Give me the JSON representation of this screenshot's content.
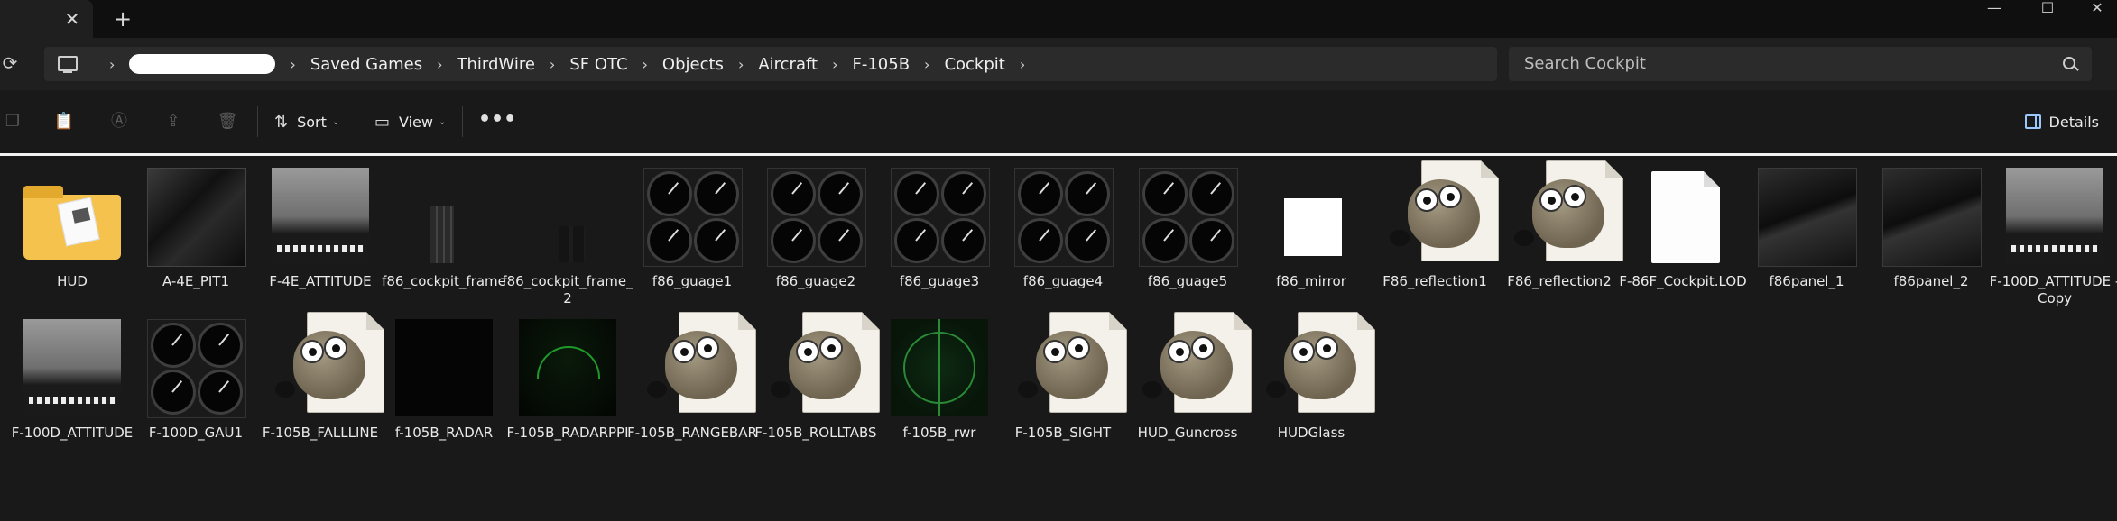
{
  "titlebar": {
    "close_tab": "✕",
    "new_tab": "+",
    "minimize": "—",
    "maximize": "☐",
    "close_window": "✕"
  },
  "address": {
    "breadcrumbs": [
      "Saved Games",
      "ThirdWire",
      "SF OTC",
      "Objects",
      "Aircraft",
      "F-105B",
      "Cockpit"
    ],
    "separator": "›",
    "search_placeholder": "Search Cockpit"
  },
  "toolbar": {
    "sort_label": "Sort",
    "view_label": "View",
    "more_label": "•••",
    "details_label": "Details",
    "chevron": "⌄"
  },
  "files": [
    {
      "name": "HUD",
      "kind": "folder"
    },
    {
      "name": "A-4E_PIT1",
      "kind": "pit"
    },
    {
      "name": "F-4E_ATTITUDE",
      "kind": "att"
    },
    {
      "name": "f86_cockpit_frame",
      "kind": "frame1"
    },
    {
      "name": "f86_cockpit_frame_2",
      "kind": "frame2"
    },
    {
      "name": "f86_guage1",
      "kind": "gauges"
    },
    {
      "name": "f86_guage2",
      "kind": "gauges"
    },
    {
      "name": "f86_guage3",
      "kind": "gauges"
    },
    {
      "name": "f86_guage4",
      "kind": "gauges"
    },
    {
      "name": "f86_guage5",
      "kind": "gauges"
    },
    {
      "name": "f86_mirror",
      "kind": "mirror"
    },
    {
      "name": "F86_reflection1",
      "kind": "gimp"
    },
    {
      "name": "F86_reflection2",
      "kind": "gimp"
    },
    {
      "name": "F-86F_Cockpit.LOD",
      "kind": "blank"
    },
    {
      "name": "f86panel_1",
      "kind": "panel"
    },
    {
      "name": "f86panel_2",
      "kind": "panel"
    },
    {
      "name": "F-100D_ATTITUDE - Copy",
      "kind": "att"
    },
    {
      "name": "F-100D_ATTITUDE",
      "kind": "att"
    },
    {
      "name": "F-100D_GAU1",
      "kind": "gauges"
    },
    {
      "name": "F-105B_FALLLINE",
      "kind": "gimp"
    },
    {
      "name": "f-105B_RADAR",
      "kind": "radar"
    },
    {
      "name": "F-105B_RADARPPI",
      "kind": "radarpi"
    },
    {
      "name": "F-105B_RANGEBAR",
      "kind": "gimp"
    },
    {
      "name": "F-105B_ROLLTABS",
      "kind": "gimp"
    },
    {
      "name": "f-105B_rwr",
      "kind": "rwr"
    },
    {
      "name": "F-105B_SIGHT",
      "kind": "gimp"
    },
    {
      "name": "HUD_Guncross",
      "kind": "gimp"
    },
    {
      "name": "HUDGlass",
      "kind": "gimp"
    }
  ]
}
